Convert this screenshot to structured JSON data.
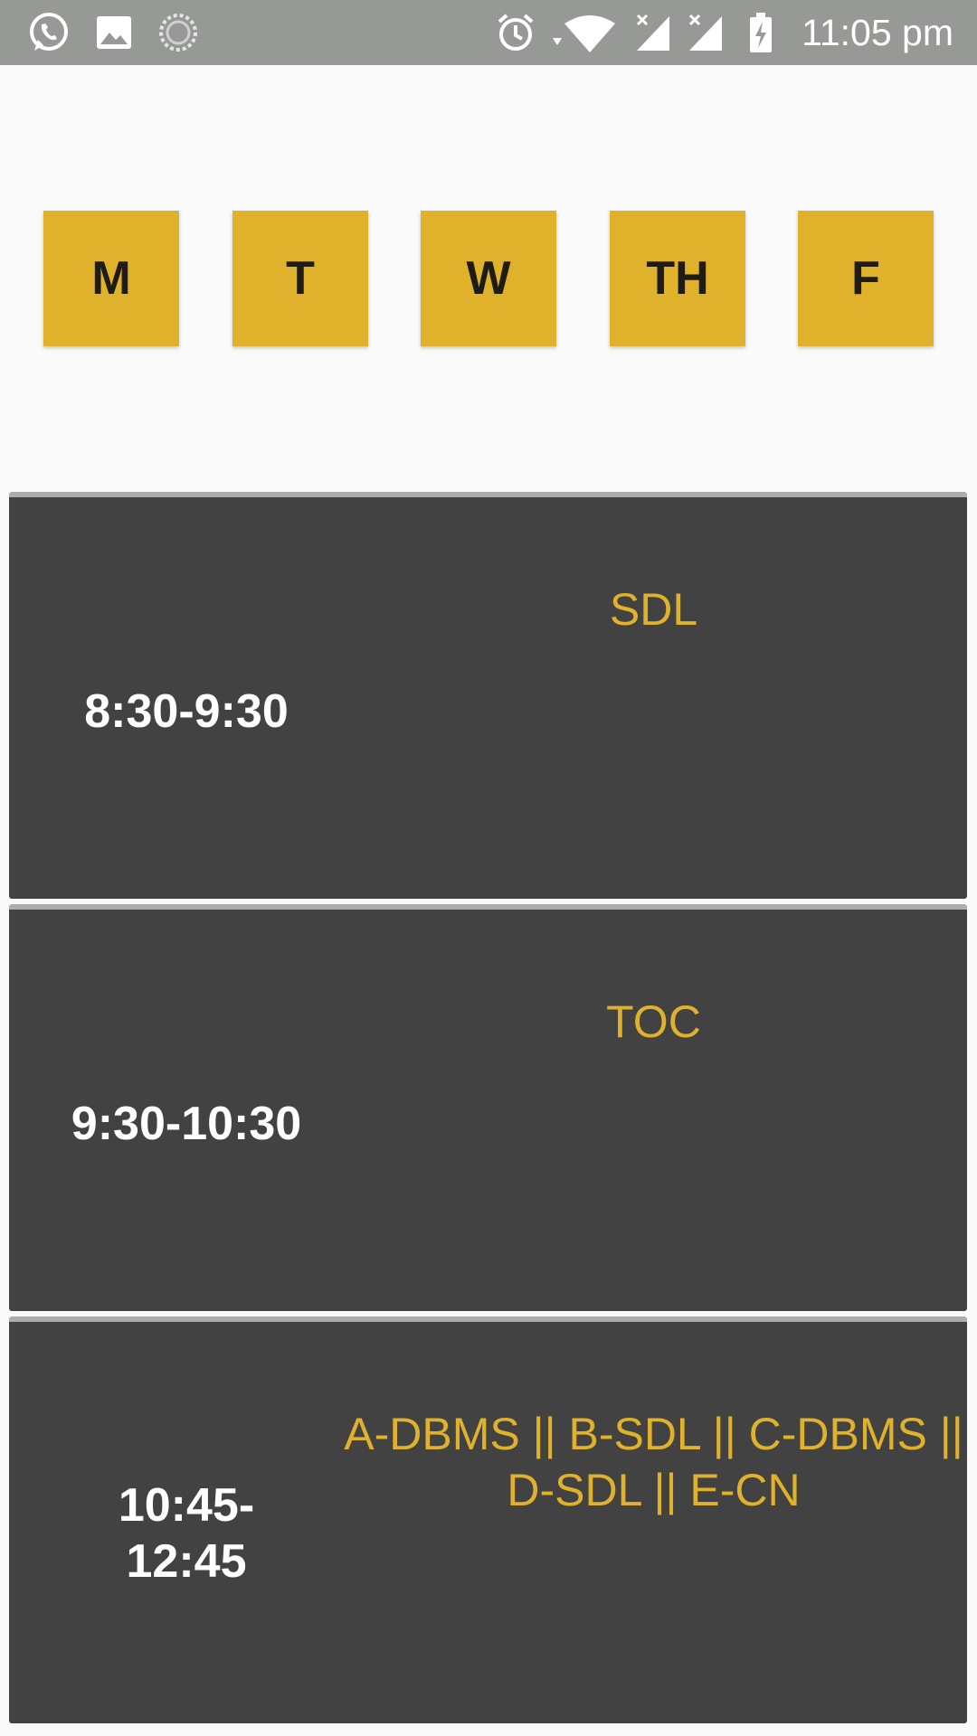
{
  "status_bar": {
    "time": "11:05 pm",
    "icons": [
      "whatsapp-icon",
      "gallery-icon",
      "loading-icon",
      "alarm-icon",
      "wifi-icon",
      "signal-sim1-icon",
      "signal-sim2-icon",
      "battery-charging-icon"
    ]
  },
  "days": [
    "M",
    "T",
    "W",
    "TH",
    "F"
  ],
  "colors": {
    "accent": "#e0b12b",
    "card": "#424242",
    "card_border": "#acacac",
    "background": "#fafafa",
    "status_bar": "#979997"
  },
  "slots": [
    {
      "time": "8:30-9:30",
      "subject": "SDL"
    },
    {
      "time": "9:30-10:30",
      "subject": "TOC"
    },
    {
      "time": "10:45-\n12:45",
      "subject": "A-DBMS || B-SDL || C-DBMS || D-SDL || E-CN"
    }
  ]
}
